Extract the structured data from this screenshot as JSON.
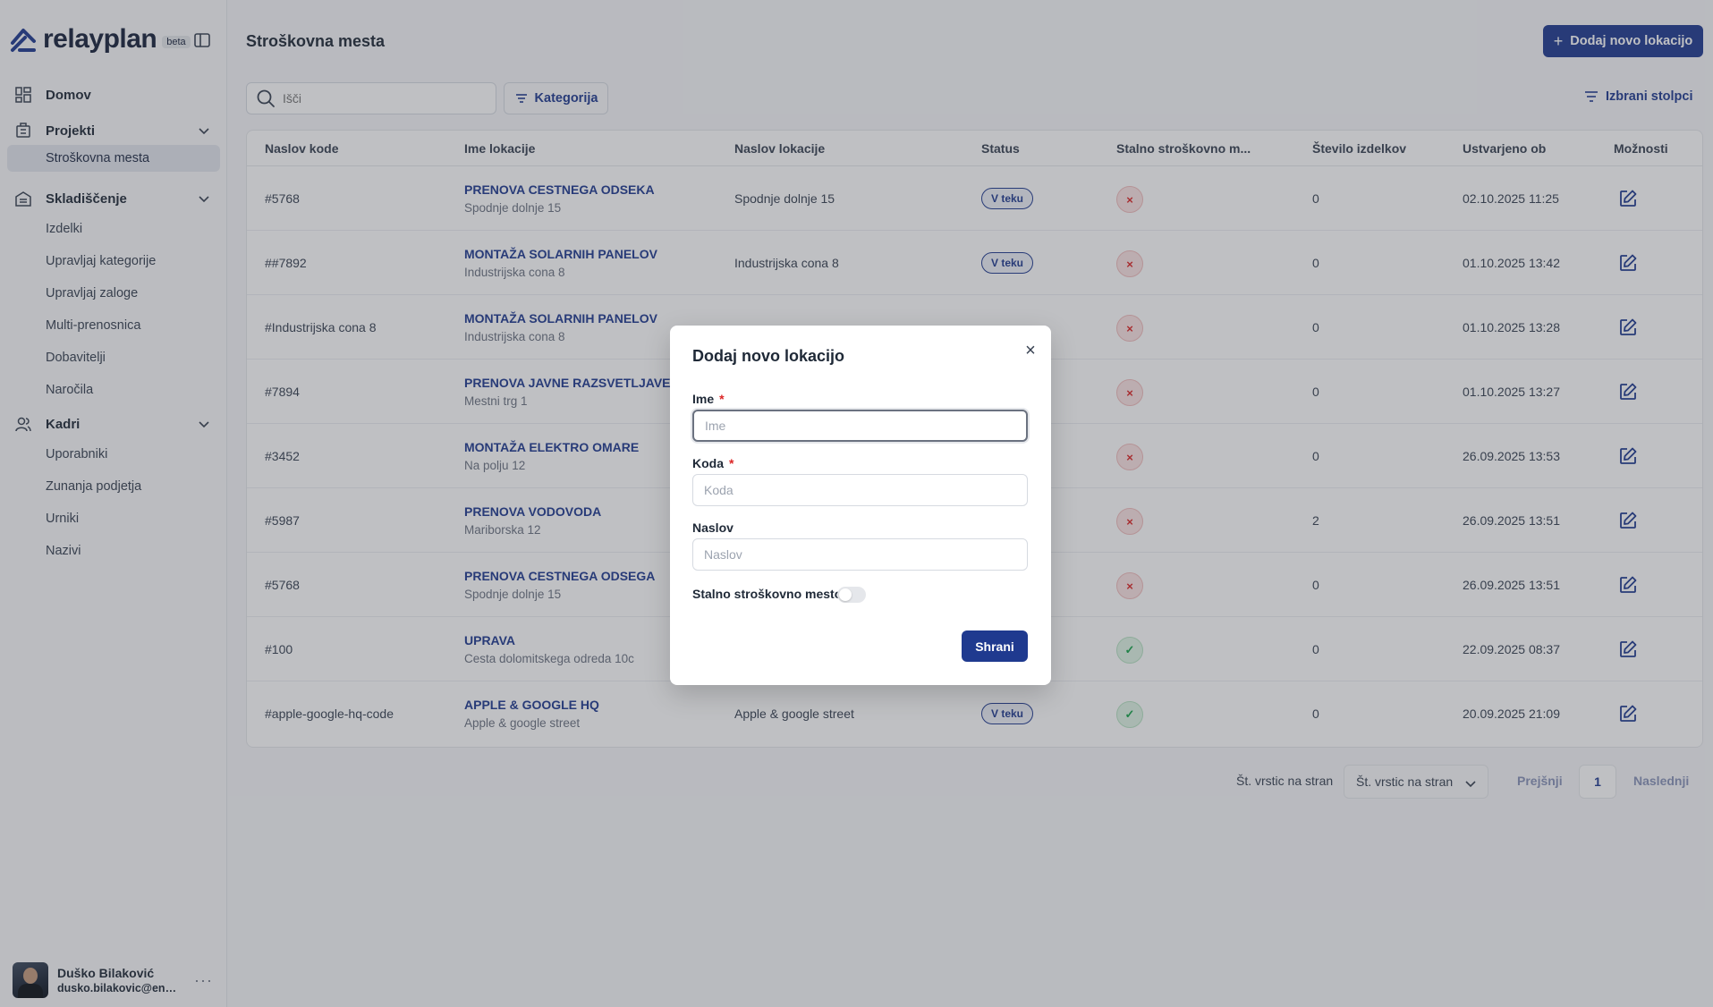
{
  "brand": {
    "name": "relayplan",
    "badge": "beta"
  },
  "sidebar": {
    "home": "Domov",
    "projects": {
      "label": "Projekti",
      "items": [
        "Stroškovna mesta"
      ]
    },
    "warehouse": {
      "label": "Skladiščenje",
      "items": [
        "Izdelki",
        "Upravljaj kategorije",
        "Upravljaj zaloge",
        "Multi-prenosnica",
        "Dobavitelji",
        "Naročila"
      ]
    },
    "staff": {
      "label": "Kadri",
      "items": [
        "Uporabniki",
        "Zunanja podjetja",
        "Urniki",
        "Nazivi"
      ]
    },
    "user": {
      "name": "Duško Bilaković",
      "email": "dusko.bilakovic@envo..."
    }
  },
  "header": {
    "title": "Stroškovna mesta",
    "add_button": "Dodaj novo lokacijo"
  },
  "toolbar": {
    "search_placeholder": "Išči",
    "filter_label": "Kategorija",
    "columns_label": "Izbrani stolpci"
  },
  "table": {
    "columns": [
      "Naslov kode",
      "Ime lokacije",
      "Naslov lokacije",
      "Status",
      "Stalno stroškovno m...",
      "Število izdelkov",
      "Ustvarjeno ob",
      "Možnosti"
    ],
    "rows": [
      {
        "code": "#5768",
        "name": "PRENOVA CESTNEGA ODSEKA",
        "sub": "Spodnje dolnje 15",
        "address": "Spodnje dolnje 15",
        "status": "V teku",
        "permanent": false,
        "count": "0",
        "created": "02.10.2025 11:25"
      },
      {
        "code": "##7892",
        "name": "MONTAŽA SOLARNIH PANELOV",
        "sub": "Industrijska cona 8",
        "address": "Industrijska cona 8",
        "status": "V teku",
        "permanent": false,
        "count": "0",
        "created": "01.10.2025 13:42"
      },
      {
        "code": "#Industrijska cona 8",
        "name": "MONTAŽA SOLARNIH PANELOV",
        "sub": "Industrijska cona 8",
        "address": "",
        "status": "",
        "permanent": false,
        "count": "0",
        "created": "01.10.2025 13:28"
      },
      {
        "code": "#7894",
        "name": "PRENOVA JAVNE RAZSVETLJAVE",
        "sub": "Mestni trg 1",
        "address": "",
        "status": "",
        "permanent": false,
        "count": "0",
        "created": "01.10.2025 13:27"
      },
      {
        "code": "#3452",
        "name": "MONTAŽA ELEKTRO OMARE",
        "sub": "Na polju 12",
        "address": "",
        "status": "",
        "permanent": false,
        "count": "0",
        "created": "26.09.2025 13:53"
      },
      {
        "code": "#5987",
        "name": "PRENOVA VODOVODA",
        "sub": "Mariborska 12",
        "address": "",
        "status": "",
        "permanent": false,
        "count": "2",
        "created": "26.09.2025 13:51"
      },
      {
        "code": "#5768",
        "name": "PRENOVA CESTNEGA ODSEGA",
        "sub": "Spodnje dolnje 15",
        "address": "",
        "status": "",
        "permanent": false,
        "count": "0",
        "created": "26.09.2025 13:51"
      },
      {
        "code": "#100",
        "name": "UPRAVA",
        "sub": "Cesta dolomitskega odreda 10c",
        "address": "",
        "status": "",
        "permanent": true,
        "count": "0",
        "created": "22.09.2025 08:37"
      },
      {
        "code": "#apple-google-hq-code",
        "name": "APPLE & GOOGLE HQ",
        "sub": "Apple & google street",
        "address": "Apple & google street",
        "status": "V teku",
        "permanent": true,
        "count": "0",
        "created": "20.09.2025 21:09"
      }
    ]
  },
  "pagination": {
    "rows_label": "Št. vrstic na stran",
    "rows_select": "Št. vrstic na stran",
    "prev": "Prejšnji",
    "page": "1",
    "next": "Naslednji"
  },
  "modal": {
    "title": "Dodaj novo lokacijo",
    "close_glyph": "×",
    "fields": [
      {
        "label": "Ime",
        "required": true,
        "placeholder": "Ime",
        "value": ""
      },
      {
        "label": "Koda",
        "required": true,
        "placeholder": "Koda",
        "value": ""
      },
      {
        "label": "Naslov",
        "required": false,
        "placeholder": "Naslov",
        "value": ""
      }
    ],
    "toggle_label": "Stalno stroškovno mesto",
    "toggle_on": false,
    "save_button": "Shrani"
  },
  "colors": {
    "primary": "#1f3a8f",
    "danger": "#dc2626",
    "success": "#16a34a"
  }
}
